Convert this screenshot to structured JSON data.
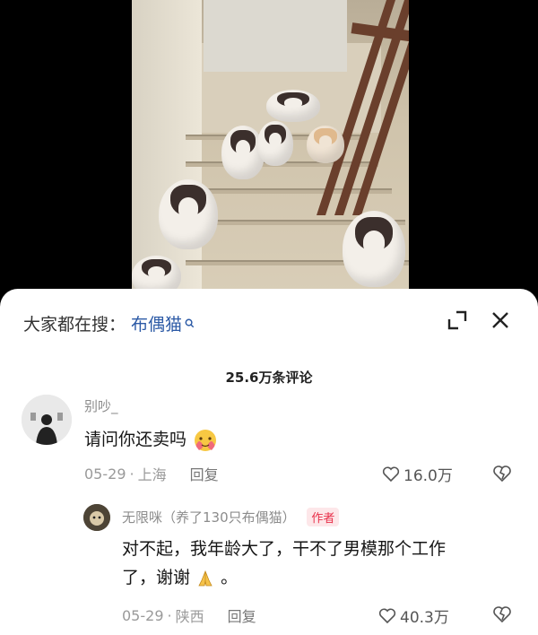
{
  "search": {
    "prefix": "大家都在搜：",
    "term": "布偶猫"
  },
  "comments_count": "25.6万条评论",
  "comments": [
    {
      "username": "别吵_",
      "text": "请问你还卖吗",
      "emoji": "heart-face-emoji",
      "date": "05-29",
      "location": "上海",
      "reply_label": "回复",
      "likes": "16.0万"
    }
  ],
  "reply": {
    "username": "无限咪（养了130只布偶猫）",
    "badge": "作者",
    "text_line1": "对不起，我年龄大了，干不了男模那个工作",
    "text_line2": "了，谢谢",
    "text_suffix": "。",
    "emoji": "pray-hands-emoji",
    "date": "05-29",
    "location": "陕西",
    "reply_label": "回复",
    "likes": "40.3万"
  },
  "icons": {
    "expand": "expand-icon",
    "close": "close-icon",
    "like": "heart-outline-icon",
    "dislike": "broken-heart-icon",
    "search": "search-icon"
  },
  "colors": {
    "link_blue": "#2c5aa6",
    "badge_red": "#e8304a",
    "badge_bg": "#fde7e9"
  }
}
